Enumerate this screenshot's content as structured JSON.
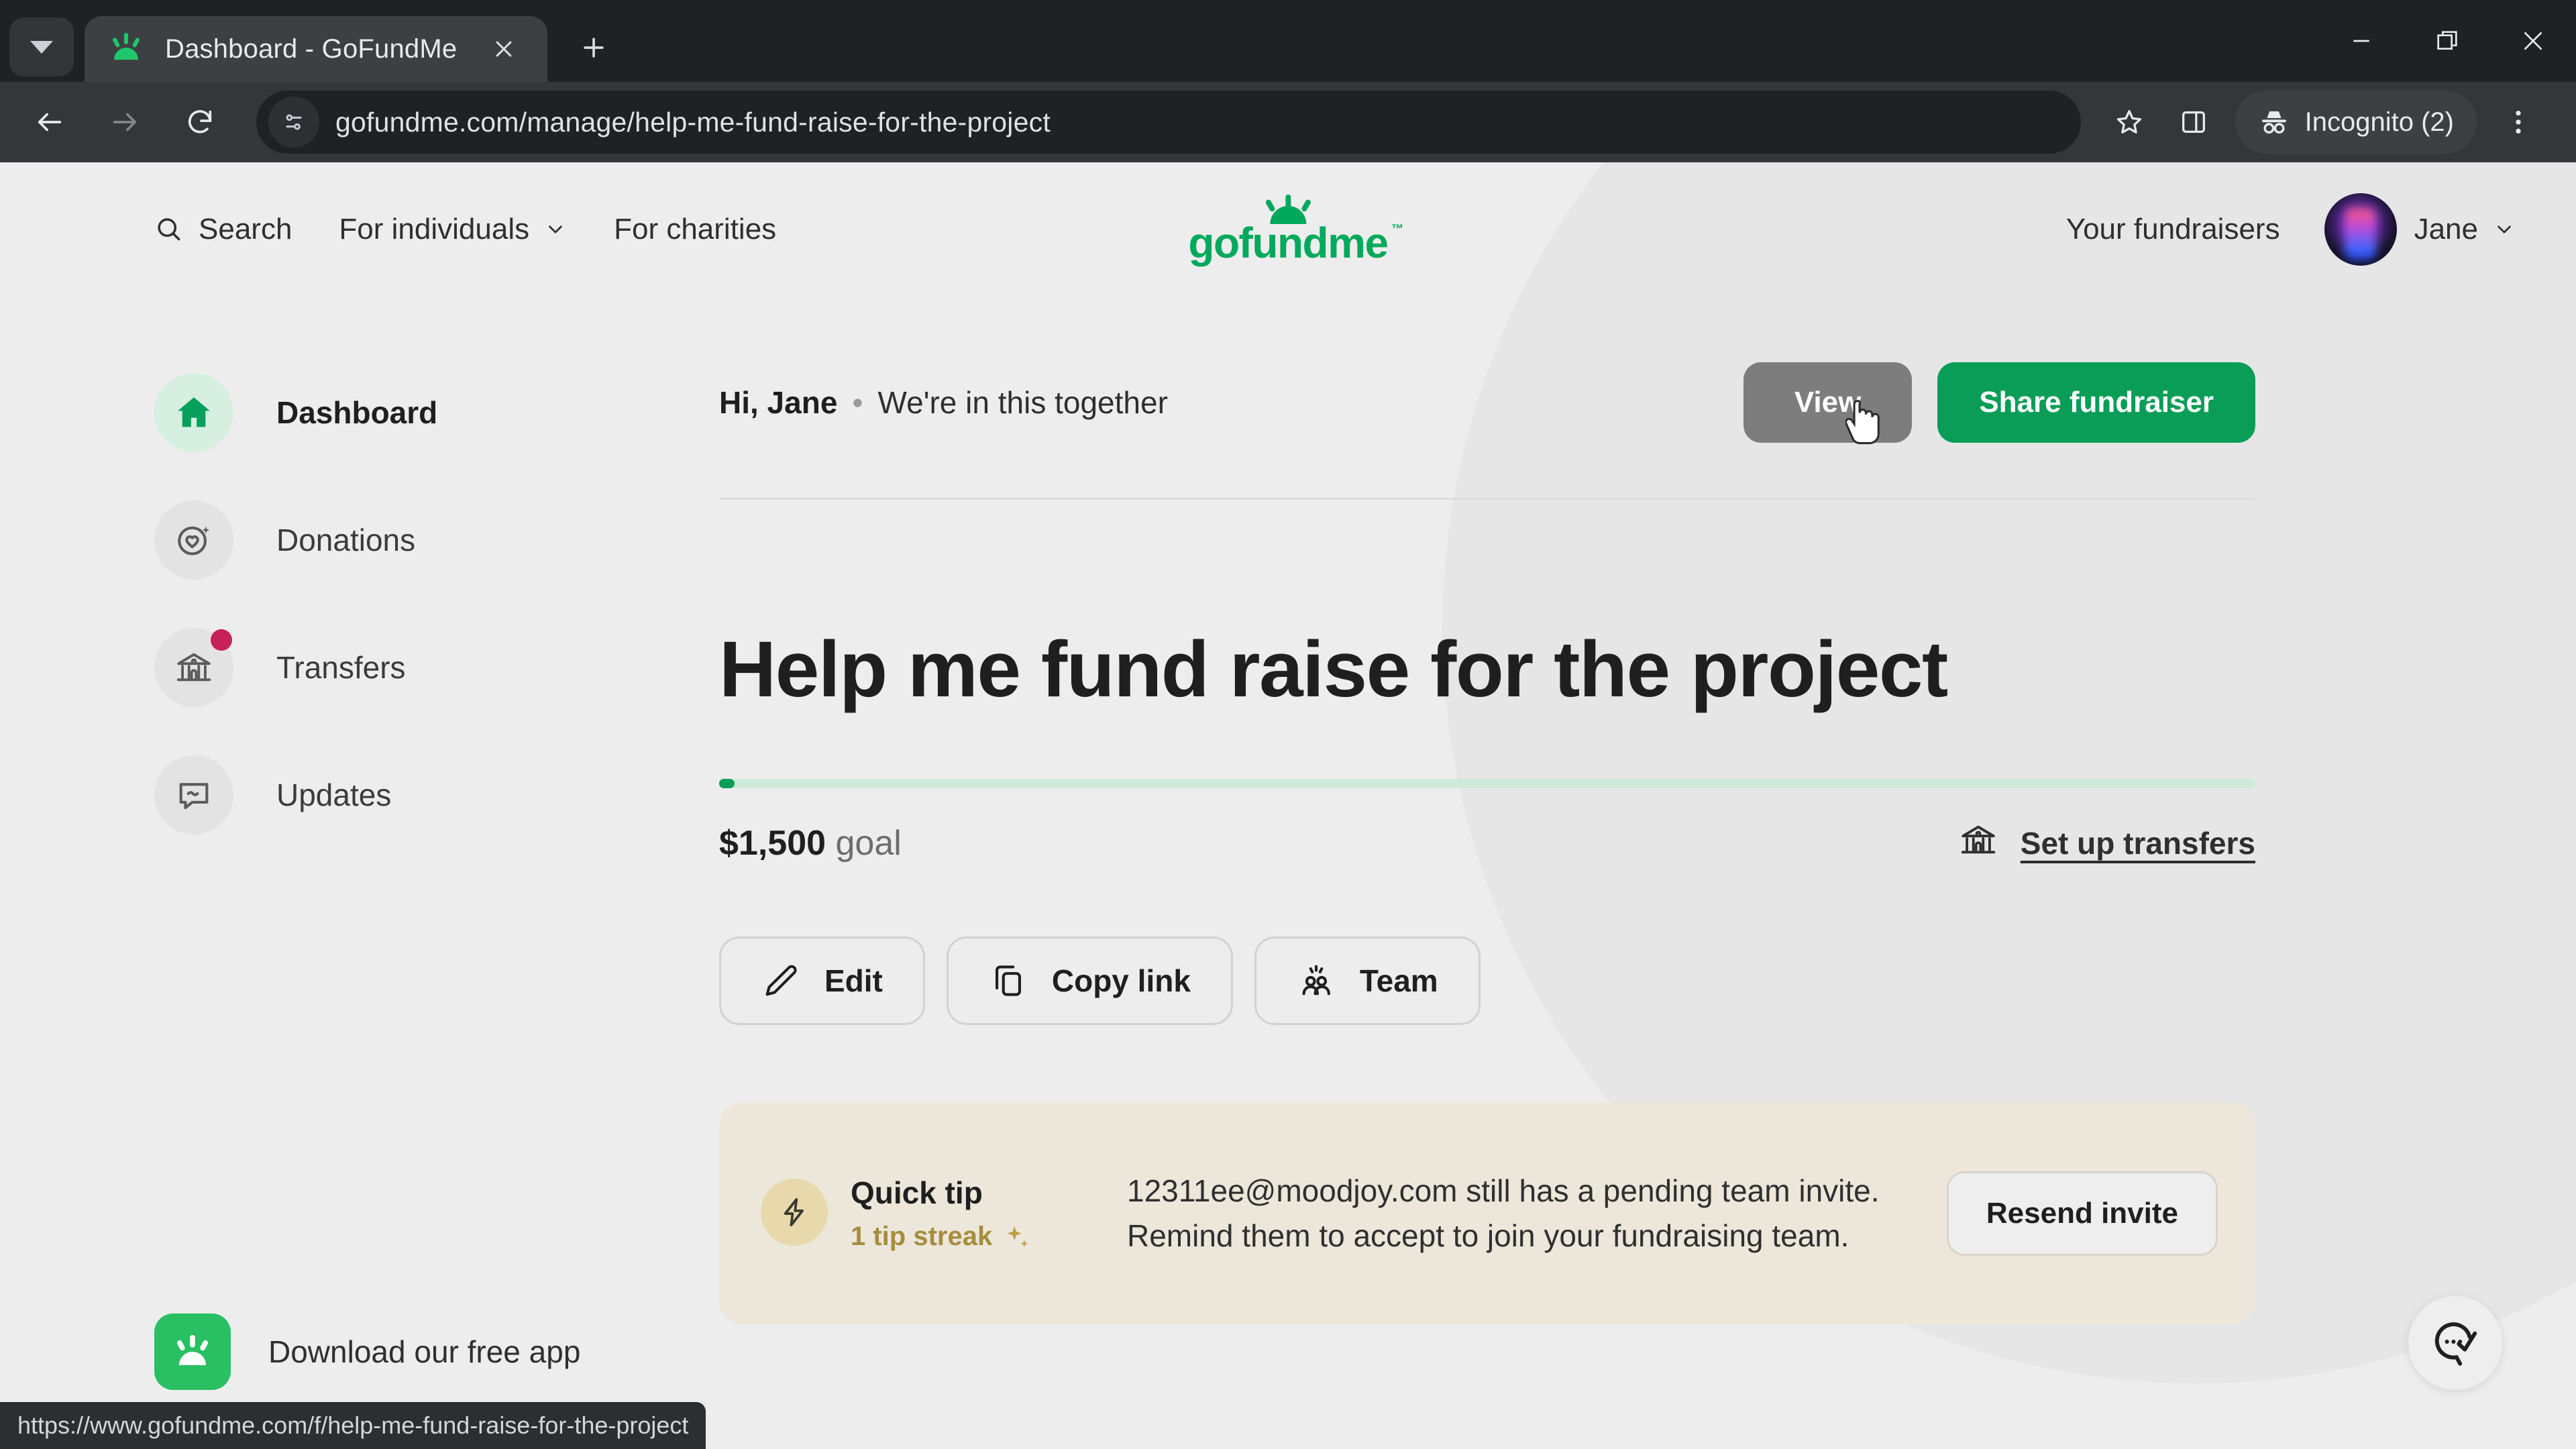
{
  "browser": {
    "tab": {
      "title": "Dashboard - GoFundMe",
      "favicon": "gofundme-favicon"
    },
    "new_tab_label": "+",
    "omnibox": {
      "url": "gofundme.com/manage/help-me-fund-raise-for-the-project"
    },
    "profile_pill": {
      "label": "Incognito (2)"
    },
    "status_bar": {
      "url": "https://www.gofundme.com/f/help-me-fund-raise-for-the-project"
    }
  },
  "site_header": {
    "search_label": "Search",
    "for_individuals_label": "For individuals",
    "for_charities_label": "For charities",
    "logo_text": "gofundme",
    "logo_tm": "™",
    "your_fundraisers_label": "Your fundraisers",
    "username": "Jane"
  },
  "sidebar": {
    "items": [
      {
        "label": "Dashboard",
        "icon": "home-icon",
        "active": true,
        "badge": false
      },
      {
        "label": "Donations",
        "icon": "donations-heart-icon",
        "active": false,
        "badge": false
      },
      {
        "label": "Transfers",
        "icon": "bank-icon",
        "active": false,
        "badge": true
      },
      {
        "label": "Updates",
        "icon": "speech-bubble-icon",
        "active": false,
        "badge": false
      }
    ],
    "app_cta": {
      "label": "Download our free app",
      "icon": "gofundme-app-icon"
    }
  },
  "main": {
    "greeting_name": "Hi, Jane",
    "greeting_separator": "•",
    "greeting_tagline": "We're in this together",
    "view_button": "View",
    "share_button": "Share fundraiser",
    "campaign_title": "Help me fund raise for the project",
    "goal_amount": "$1,500",
    "goal_suffix": "goal",
    "progress_percent": 1,
    "setup_transfers_link": "Set up transfers",
    "actions": [
      {
        "label": "Edit",
        "icon": "pencil-icon"
      },
      {
        "label": "Copy link",
        "icon": "copy-icon"
      },
      {
        "label": "Team",
        "icon": "team-icon"
      }
    ],
    "tip_card": {
      "title": "Quick tip",
      "streak": "1 tip streak",
      "streak_icon": "sparkle-icon",
      "icon": "lightning-bolt-icon",
      "body": "12311ee@moodjoy.com still has a pending team invite. Remind them to accept to join your fundraising team.",
      "button": "Resend invite"
    }
  },
  "support_fab": {
    "icon": "chat-check-icon"
  },
  "colors": {
    "brand_green": "#02a95c",
    "cta_green": "#0a9d58",
    "badge_red": "#c8215a",
    "tip_bg": "#ece7da",
    "page_bg": "#ededed"
  }
}
